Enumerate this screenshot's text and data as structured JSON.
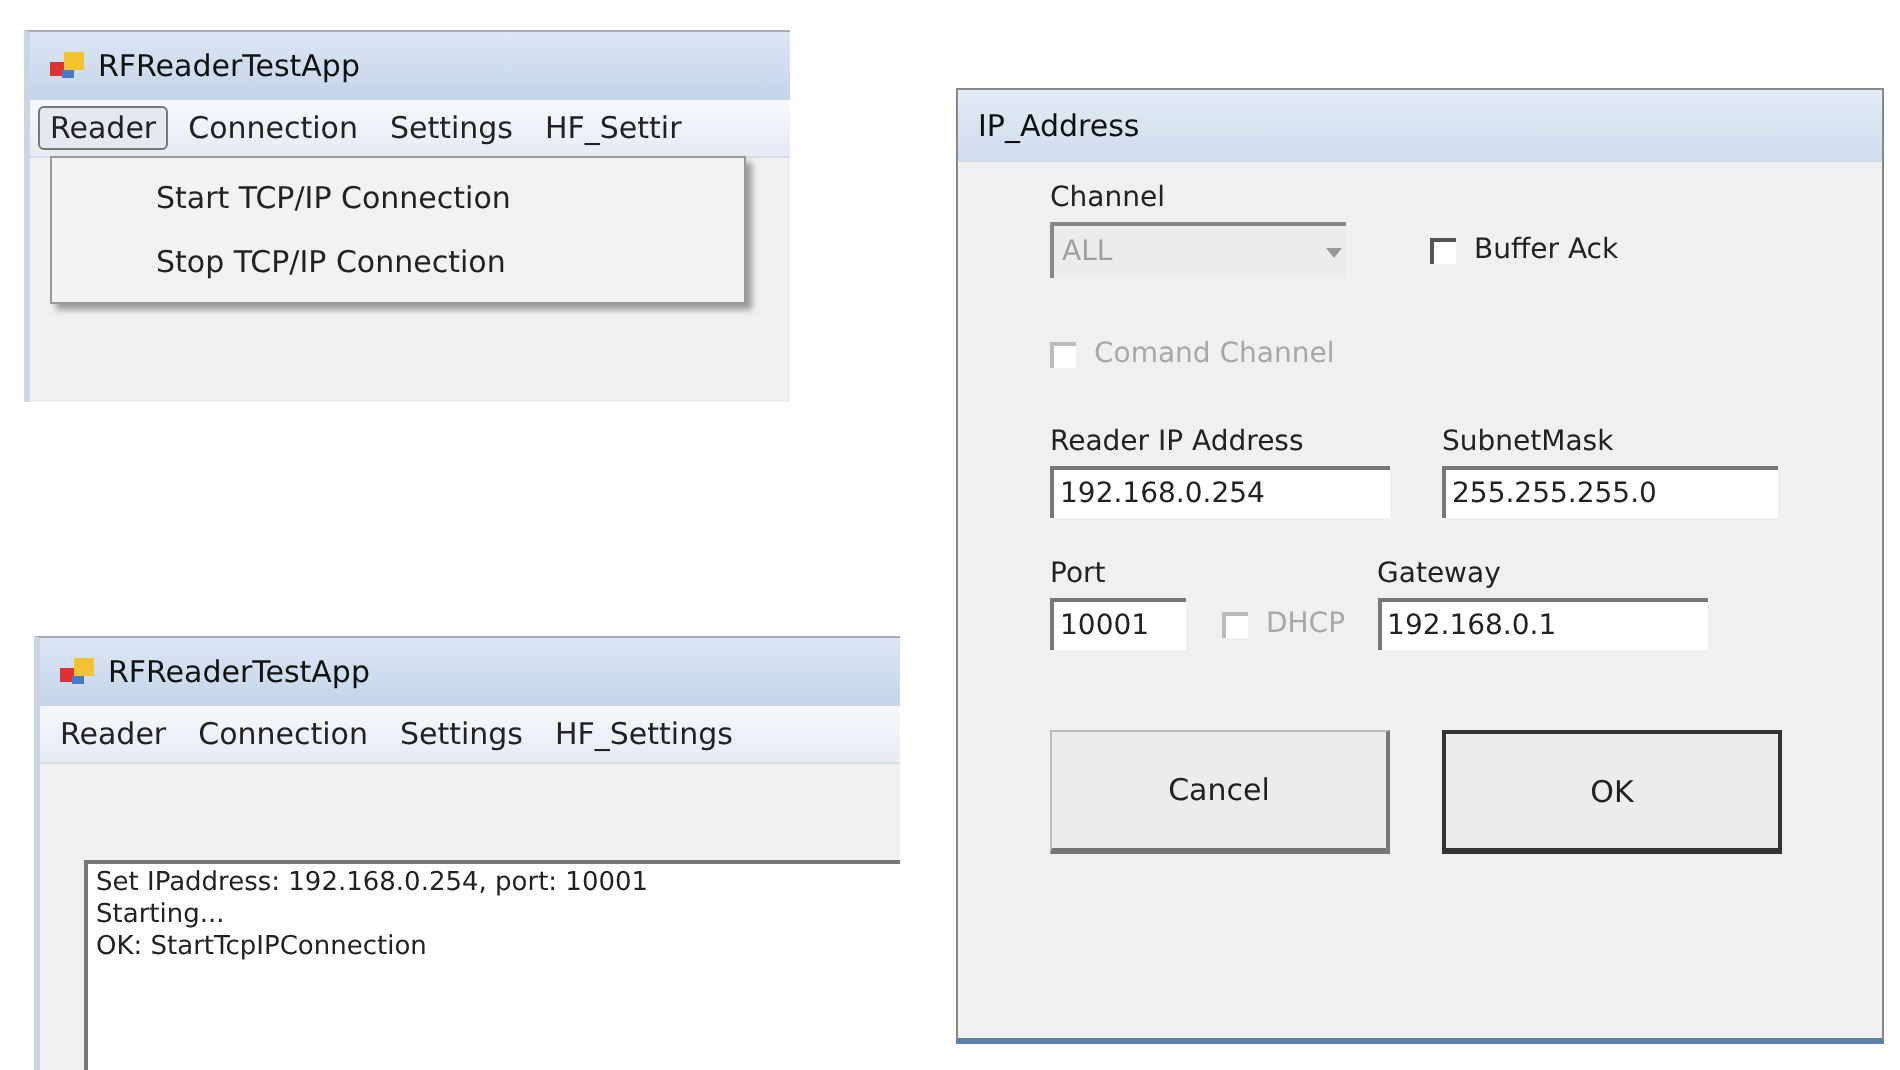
{
  "top_window": {
    "title": "RFReaderTestApp",
    "menu": [
      {
        "label": "Reader",
        "selected": true
      },
      {
        "label": "Connection",
        "selected": false
      },
      {
        "label": "Settings",
        "selected": false
      },
      {
        "label": "HF_Settir",
        "selected": false
      }
    ],
    "dropdown": {
      "expanded": true,
      "items": [
        "Start TCP/IP Connection",
        "Stop TCP/IP Connection"
      ]
    }
  },
  "bottom_window": {
    "title": "RFReaderTestApp",
    "menu": [
      {
        "label": "Reader",
        "selected": false
      },
      {
        "label": "Connection",
        "selected": false
      },
      {
        "label": "Settings",
        "selected": false
      },
      {
        "label": "HF_Settings",
        "selected": false
      }
    ],
    "log": [
      "Set IPaddress: 192.168.0.254, port: 10001",
      "Starting...",
      "OK: StartTcpIPConnection"
    ]
  },
  "dialog": {
    "title": "IP_Address",
    "channel": {
      "label": "Channel",
      "value": "ALL",
      "disabled": true
    },
    "buffer_ack": {
      "label": "Buffer  Ack",
      "checked": false,
      "disabled": false
    },
    "command_channel": {
      "label": "Comand Channel",
      "checked": false,
      "disabled": true
    },
    "reader_ip": {
      "label": "Reader IP Address",
      "value": "192.168.0.254"
    },
    "subnet_mask": {
      "label": "SubnetMask",
      "value": "255.255.255.0"
    },
    "port": {
      "label": "Port",
      "value": "10001"
    },
    "dhcp": {
      "label": "DHCP",
      "checked": false,
      "disabled": true
    },
    "gateway": {
      "label": "Gateway",
      "value": "192.168.0.1"
    },
    "buttons": [
      {
        "label": "Cancel",
        "default": false
      },
      {
        "label": "OK",
        "default": true
      }
    ]
  }
}
